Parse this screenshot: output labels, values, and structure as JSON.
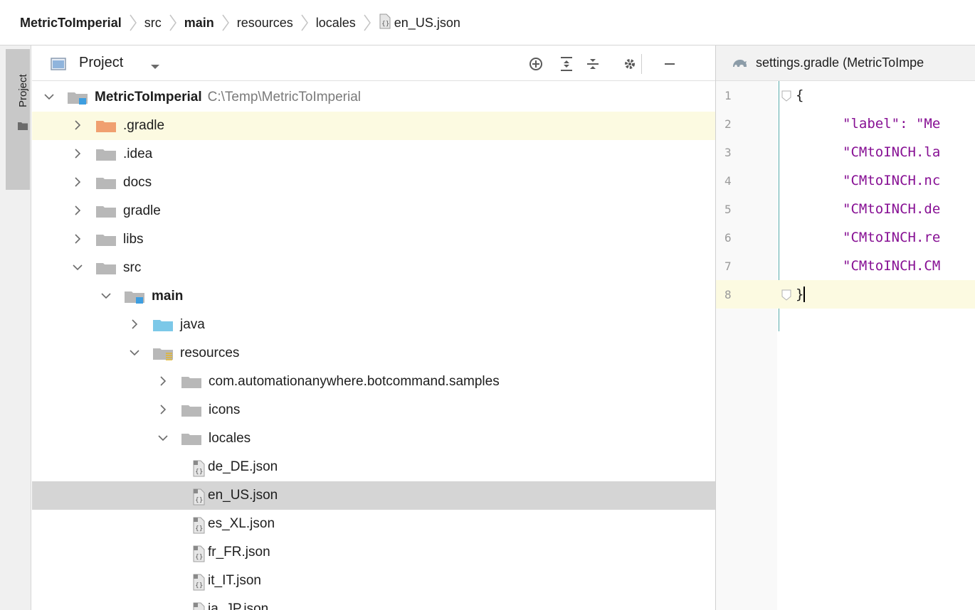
{
  "breadcrumb": [
    {
      "label": "MetricToImperial",
      "bold": true
    },
    {
      "label": "src",
      "bold": false
    },
    {
      "label": "main",
      "bold": true
    },
    {
      "label": "resources",
      "bold": false
    },
    {
      "label": "locales",
      "bold": false
    },
    {
      "label": "en_US.json",
      "bold": false,
      "icon": "json-file-icon"
    }
  ],
  "toolstrip": {
    "project_tab_label": "Project"
  },
  "project_panel": {
    "title": "Project",
    "header_icons": [
      "locate-icon",
      "expand-all-icon",
      "collapse-all-icon",
      "gear-icon",
      "minimize-icon"
    ]
  },
  "tree": [
    {
      "label": "MetricToImperial",
      "path": "C:\\Temp\\MetricToImperial",
      "depth": 0,
      "expanded": true,
      "icon": "module-folder-icon",
      "bold": true
    },
    {
      "label": ".gradle",
      "depth": 1,
      "expanded": false,
      "icon": "folder-excluded-icon",
      "highlight": "yellow"
    },
    {
      "label": ".idea",
      "depth": 1,
      "expanded": false,
      "icon": "folder-icon"
    },
    {
      "label": "docs",
      "depth": 1,
      "expanded": false,
      "icon": "folder-icon"
    },
    {
      "label": "gradle",
      "depth": 1,
      "expanded": false,
      "icon": "folder-icon"
    },
    {
      "label": "libs",
      "depth": 1,
      "expanded": false,
      "icon": "folder-icon"
    },
    {
      "label": "src",
      "depth": 1,
      "expanded": true,
      "icon": "folder-icon"
    },
    {
      "label": "main",
      "depth": 2,
      "expanded": true,
      "icon": "module-folder-icon",
      "bold": true
    },
    {
      "label": "java",
      "depth": 3,
      "expanded": false,
      "icon": "source-folder-icon"
    },
    {
      "label": "resources",
      "depth": 3,
      "expanded": true,
      "icon": "resources-folder-icon"
    },
    {
      "label": "com.automationanywhere.botcommand.samples",
      "depth": 4,
      "expanded": false,
      "icon": "folder-icon"
    },
    {
      "label": "icons",
      "depth": 4,
      "expanded": false,
      "icon": "folder-icon"
    },
    {
      "label": "locales",
      "depth": 4,
      "expanded": true,
      "icon": "folder-icon"
    },
    {
      "label": "de_DE.json",
      "depth": 5,
      "icon": "json-file-icon"
    },
    {
      "label": "en_US.json",
      "depth": 5,
      "icon": "json-file-icon",
      "highlight": "grey"
    },
    {
      "label": "es_XL.json",
      "depth": 5,
      "icon": "json-file-icon"
    },
    {
      "label": "fr_FR.json",
      "depth": 5,
      "icon": "json-file-icon"
    },
    {
      "label": "it_IT.json",
      "depth": 5,
      "icon": "json-file-icon"
    },
    {
      "label": "ja_JP.json",
      "depth": 5,
      "icon": "json-file-icon"
    }
  ],
  "editor": {
    "tab_label": "settings.gradle (MetricToImpe",
    "tab_icon": "gradle-icon",
    "lines": [
      {
        "n": "1",
        "text": "{",
        "kind": "brace"
      },
      {
        "n": "2",
        "text": "\"label\": \"Me",
        "kind": "str"
      },
      {
        "n": "3",
        "text": "\"CMtoINCH.la",
        "kind": "str"
      },
      {
        "n": "4",
        "text": "\"CMtoINCH.nc",
        "kind": "str"
      },
      {
        "n": "5",
        "text": "\"CMtoINCH.de",
        "kind": "str"
      },
      {
        "n": "6",
        "text": "\"CMtoINCH.re",
        "kind": "str"
      },
      {
        "n": "7",
        "text": "\"CMtoINCH.CM",
        "kind": "str"
      },
      {
        "n": "8",
        "text": "}",
        "kind": "brace",
        "current": true
      }
    ]
  },
  "colors": {
    "current_line": "#fcfae1",
    "selection": "#d5d5d5",
    "string": "#871094",
    "folder": "#b8b8b8",
    "folder_excluded": "#f0a070",
    "source_folder": "#7cc8e8"
  }
}
